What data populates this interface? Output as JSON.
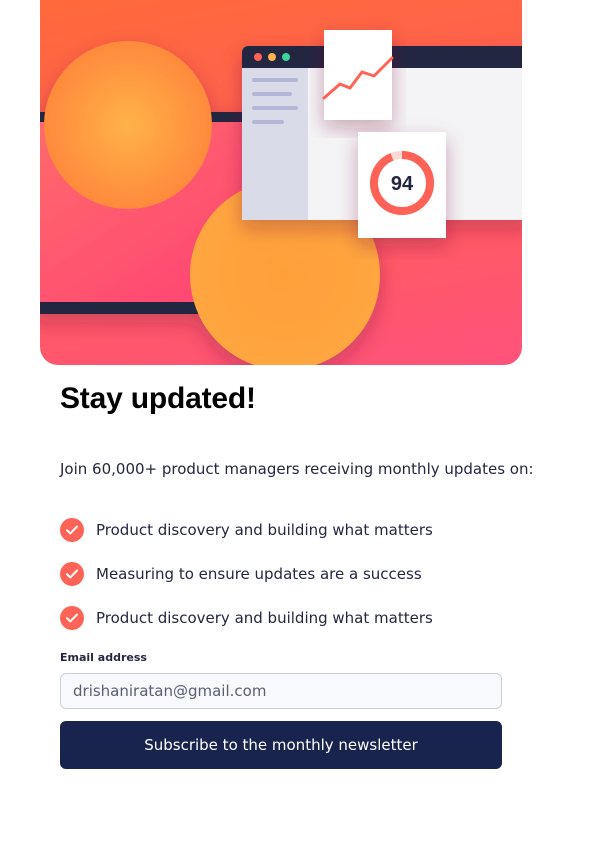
{
  "hero": {
    "score": "94",
    "icons": [
      "laptop-illustration",
      "browser-window",
      "line-chart-card",
      "score-ring-card"
    ]
  },
  "heading": "Stay updated!",
  "intro": "Join 60,000+ product managers receiving monthly updates on:",
  "features": [
    "Product discovery and building what matters",
    "Measuring to ensure updates are a success",
    "Product discovery and building what matters"
  ],
  "form": {
    "email_label": "Email address",
    "email_value": "drishaniratan@gmail.com",
    "submit_label": "Subscribe to the monthly newsletter"
  },
  "colors": {
    "accent": "#ff6257",
    "button": "#19244e",
    "text": "#242742"
  }
}
